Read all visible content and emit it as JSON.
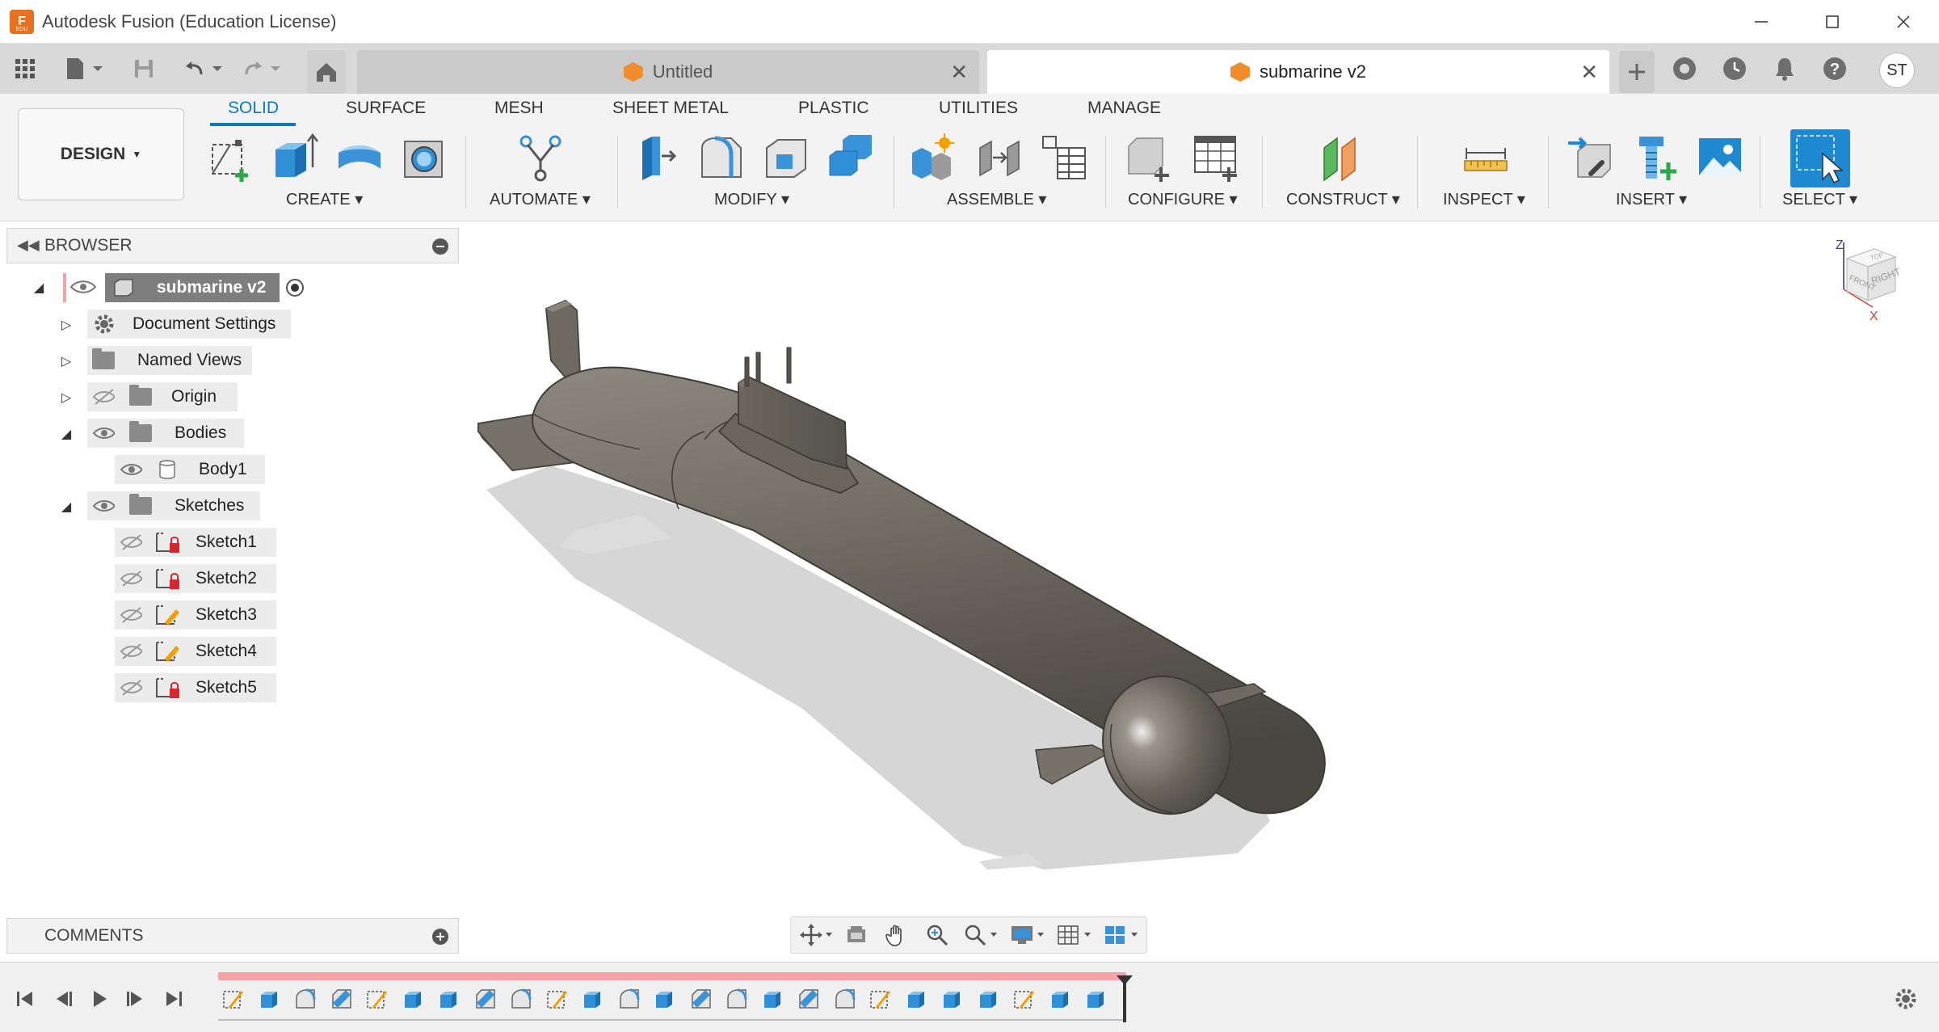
{
  "window": {
    "title": "Autodesk Fusion (Education License)",
    "logo_letter": "F",
    "logo_sub": "EDU"
  },
  "tabs": [
    {
      "label": "Untitled",
      "active": false
    },
    {
      "label": "submarine v2",
      "active": true
    }
  ],
  "user": {
    "initials": "ST"
  },
  "toolbar": {
    "workspace": "DESIGN",
    "ws_tabs": [
      "SOLID",
      "SURFACE",
      "MESH",
      "SHEET METAL",
      "PLASTIC",
      "UTILITIES",
      "MANAGE"
    ],
    "groups": [
      "CREATE",
      "AUTOMATE",
      "MODIFY",
      "ASSEMBLE",
      "CONFIGURE",
      "CONSTRUCT",
      "INSPECT",
      "INSERT",
      "SELECT"
    ]
  },
  "browser": {
    "title": "BROWSER",
    "root": "submarine v2",
    "items": [
      {
        "label": "Document Settings"
      },
      {
        "label": "Named Views"
      },
      {
        "label": "Origin"
      },
      {
        "label": "Bodies"
      },
      {
        "label": "Body1"
      },
      {
        "label": "Sketches"
      },
      {
        "label": "Sketch1"
      },
      {
        "label": "Sketch2"
      },
      {
        "label": "Sketch3"
      },
      {
        "label": "Sketch4"
      },
      {
        "label": "Sketch5"
      }
    ]
  },
  "comments": {
    "title": "COMMENTS"
  },
  "viewcube": {
    "axis_z": "Z",
    "axis_x": "X",
    "face_top": "TOP",
    "face_front": "FRONT",
    "face_right": "RIGHT"
  },
  "colors": {
    "accent": "#0a7bc2",
    "timeline_strip": "#f4a3a8",
    "tab_icon": "#f28c28",
    "body": "#6f6a60"
  }
}
